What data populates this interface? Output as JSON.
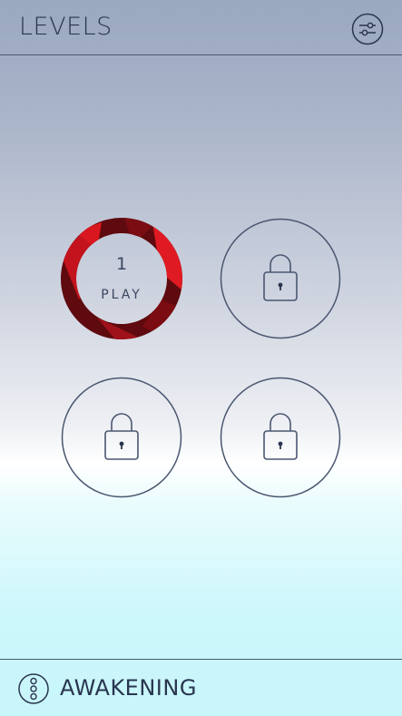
{
  "header": {
    "title": "LEVELS",
    "settings_icon": "sliders-icon"
  },
  "levels": [
    {
      "number": "1",
      "action": "PLAY",
      "state": "unlocked",
      "accent": "#c3131c"
    },
    {
      "state": "locked",
      "icon": "lock-icon"
    },
    {
      "state": "locked",
      "icon": "lock-icon"
    },
    {
      "state": "locked",
      "icon": "lock-icon"
    }
  ],
  "footer": {
    "icon": "three-dots-icon",
    "label": "AWAKENING"
  },
  "colors": {
    "text": "#2a3550",
    "outline": "#4a5770",
    "ring_dark": "#5e0a0e",
    "ring_red": "#c3131c"
  }
}
